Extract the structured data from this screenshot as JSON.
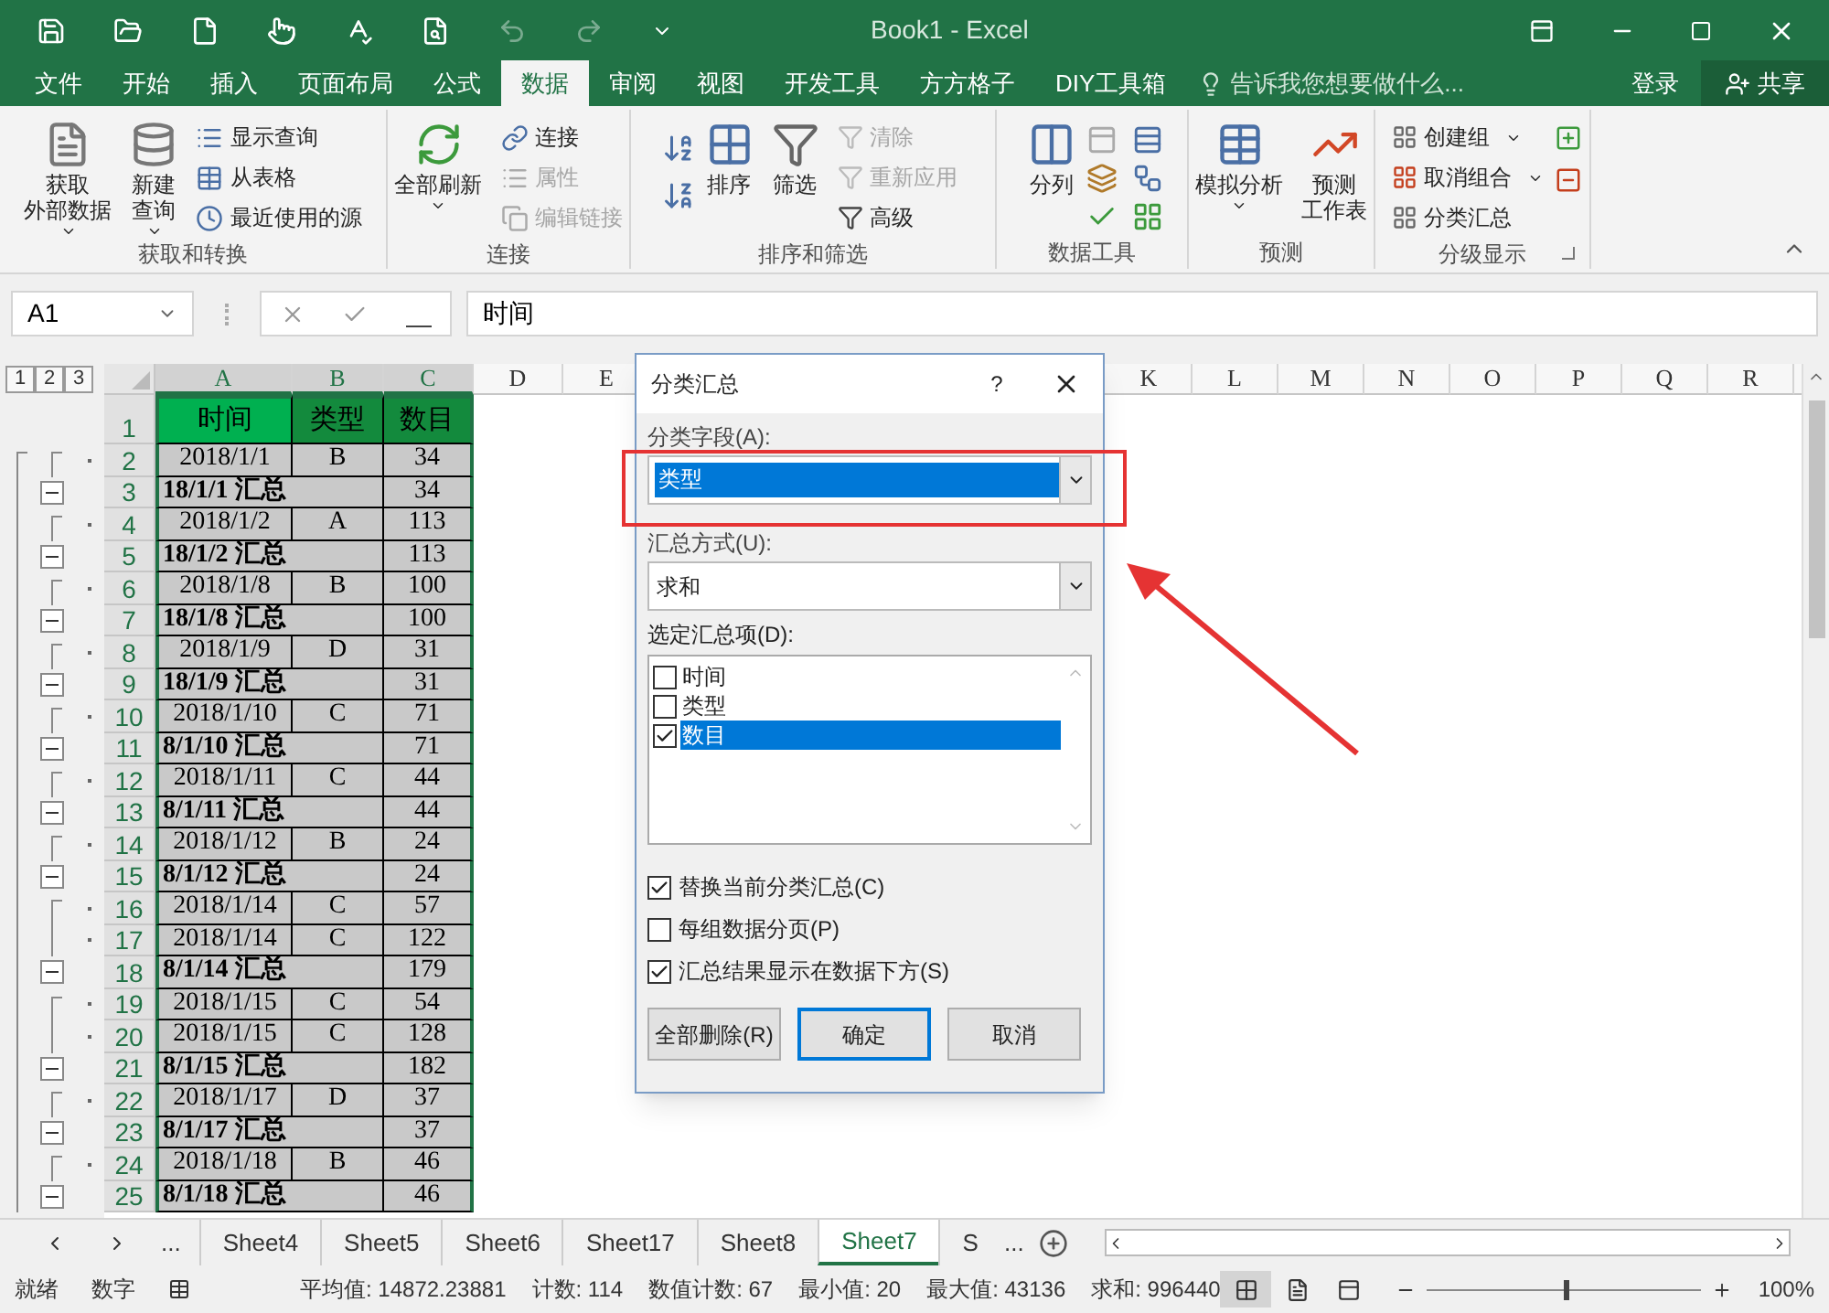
{
  "title_bar": {
    "title": "Book1 - Excel",
    "undo": {
      "disabled": true
    },
    "redo": {
      "disabled": true
    }
  },
  "menu_tabs": [
    {
      "label": "文件",
      "selected": false
    },
    {
      "label": "开始",
      "selected": false
    },
    {
      "label": "插入",
      "selected": false
    },
    {
      "label": "页面布局",
      "selected": false
    },
    {
      "label": "公式",
      "selected": false
    },
    {
      "label": "数据",
      "selected": true
    },
    {
      "label": "审阅",
      "selected": false
    },
    {
      "label": "视图",
      "selected": false
    },
    {
      "label": "开发工具",
      "selected": false
    },
    {
      "label": "方方格子",
      "selected": false
    },
    {
      "label": "DIY工具箱",
      "selected": false
    }
  ],
  "tell_me": {
    "placeholder": "告诉我您想要做什么..."
  },
  "sign_in": "登录",
  "share": "共享",
  "ribbon": {
    "groups": [
      {
        "label": "获取和转换",
        "large": [
          {
            "lines": [
              "获取",
              "外部数据"
            ]
          },
          {
            "lines": [
              "新建",
              "查询"
            ]
          }
        ],
        "small": [
          {
            "label": "显示查询"
          },
          {
            "label": "从表格"
          },
          {
            "label": "最近使用的源"
          }
        ]
      },
      {
        "label": "连接",
        "large": [
          {
            "lines": [
              "全部刷新"
            ]
          }
        ],
        "small": [
          {
            "label": "连接",
            "disabled": false
          },
          {
            "label": "属性",
            "disabled": true
          },
          {
            "label": "编辑链接",
            "disabled": true
          }
        ]
      },
      {
        "label": "排序和筛选",
        "large": [
          {
            "lines": [
              "排序"
            ]
          },
          {
            "lines": [
              "筛选"
            ]
          }
        ],
        "small": [
          {
            "label": "清除",
            "disabled": true
          },
          {
            "label": "重新应用",
            "disabled": true
          },
          {
            "label": "高级",
            "disabled": false
          }
        ]
      },
      {
        "label": "数据工具",
        "large": [
          {
            "lines": [
              "分列"
            ]
          }
        ]
      },
      {
        "label": "预测",
        "large": [
          {
            "lines": [
              "模拟分析"
            ]
          },
          {
            "lines": [
              "预测",
              "工作表"
            ]
          }
        ]
      },
      {
        "label": "分级显示",
        "small": [
          {
            "label": "创建组"
          },
          {
            "label": "取消组合"
          },
          {
            "label": "分类汇总"
          }
        ]
      }
    ]
  },
  "formula_bar": {
    "name_box": "A1",
    "value": "时间"
  },
  "outline_levels": [
    "1",
    "2",
    "3"
  ],
  "columns": [
    {
      "label": "A",
      "selected": true
    },
    {
      "label": "B",
      "selected": true
    },
    {
      "label": "C",
      "selected": true
    },
    {
      "label": "D",
      "selected": false
    },
    {
      "label": "E",
      "selected": false
    },
    {
      "label": "K",
      "selected": false
    },
    {
      "label": "L",
      "selected": false
    },
    {
      "label": "M",
      "selected": false
    },
    {
      "label": "N",
      "selected": false
    },
    {
      "label": "O",
      "selected": false
    },
    {
      "label": "P",
      "selected": false
    },
    {
      "label": "Q",
      "selected": false
    },
    {
      "label": "R",
      "selected": false
    }
  ],
  "rows": [
    {
      "num": "1",
      "kind": "header",
      "a": "时间",
      "b": "类型",
      "c": "数目"
    },
    {
      "num": "2",
      "kind": "detail",
      "a": "2018/1/1",
      "b": "B",
      "c": "34"
    },
    {
      "num": "3",
      "kind": "subtotal",
      "a": "18/1/1 汇总",
      "c": "34"
    },
    {
      "num": "4",
      "kind": "detail",
      "a": "2018/1/2",
      "b": "A",
      "c": "113"
    },
    {
      "num": "5",
      "kind": "subtotal",
      "a": "18/1/2 汇总",
      "c": "113"
    },
    {
      "num": "6",
      "kind": "detail",
      "a": "2018/1/8",
      "b": "B",
      "c": "100"
    },
    {
      "num": "7",
      "kind": "subtotal",
      "a": "18/1/8 汇总",
      "c": "100"
    },
    {
      "num": "8",
      "kind": "detail",
      "a": "2018/1/9",
      "b": "D",
      "c": "31"
    },
    {
      "num": "9",
      "kind": "subtotal",
      "a": "18/1/9 汇总",
      "c": "31"
    },
    {
      "num": "10",
      "kind": "detail",
      "a": "2018/1/10",
      "b": "C",
      "c": "71"
    },
    {
      "num": "11",
      "kind": "subtotal",
      "a": "8/1/10 汇总",
      "c": "71"
    },
    {
      "num": "12",
      "kind": "detail",
      "a": "2018/1/11",
      "b": "C",
      "c": "44"
    },
    {
      "num": "13",
      "kind": "subtotal",
      "a": "8/1/11 汇总",
      "c": "44"
    },
    {
      "num": "14",
      "kind": "detail",
      "a": "2018/1/12",
      "b": "B",
      "c": "24"
    },
    {
      "num": "15",
      "kind": "subtotal",
      "a": "8/1/12 汇总",
      "c": "24"
    },
    {
      "num": "16",
      "kind": "detail",
      "a": "2018/1/14",
      "b": "C",
      "c": "57"
    },
    {
      "num": "17",
      "kind": "detail",
      "a": "2018/1/14",
      "b": "C",
      "c": "122"
    },
    {
      "num": "18",
      "kind": "subtotal",
      "a": "8/1/14 汇总",
      "c": "179"
    },
    {
      "num": "19",
      "kind": "detail",
      "a": "2018/1/15",
      "b": "C",
      "c": "54"
    },
    {
      "num": "20",
      "kind": "detail",
      "a": "2018/1/15",
      "b": "C",
      "c": "128"
    },
    {
      "num": "21",
      "kind": "subtotal",
      "a": "8/1/15 汇总",
      "c": "182"
    },
    {
      "num": "22",
      "kind": "detail",
      "a": "2018/1/17",
      "b": "D",
      "c": "37"
    },
    {
      "num": "23",
      "kind": "subtotal",
      "a": "8/1/17 汇总",
      "c": "37"
    },
    {
      "num": "24",
      "kind": "detail",
      "a": "2018/1/18",
      "b": "B",
      "c": "46"
    },
    {
      "num": "25",
      "kind": "subtotal",
      "a": "8/1/18 汇总",
      "c": "46"
    }
  ],
  "dialog": {
    "title": "分类汇总",
    "help": "?",
    "field_label": "分类字段(A):",
    "field_value": "类型",
    "func_label": "汇总方式(U):",
    "func_value": "求和",
    "items_label": "选定汇总项(D):",
    "items": [
      {
        "label": "时间",
        "checked": false,
        "selected": false
      },
      {
        "label": "类型",
        "checked": false,
        "selected": false
      },
      {
        "label": "数目",
        "checked": true,
        "selected": true
      }
    ],
    "options": [
      {
        "label": "替换当前分类汇总(C)",
        "checked": true
      },
      {
        "label": "每组数据分页(P)",
        "checked": false
      },
      {
        "label": "汇总结果显示在数据下方(S)",
        "checked": true
      }
    ],
    "buttons": [
      {
        "label": "全部删除(R)",
        "default": false
      },
      {
        "label": "确定",
        "default": true
      },
      {
        "label": "取消",
        "default": false
      }
    ]
  },
  "sheet_tabs": {
    "overflow_left": "...",
    "tabs": [
      {
        "label": "Sheet4",
        "selected": false
      },
      {
        "label": "Sheet5",
        "selected": false
      },
      {
        "label": "Sheet6",
        "selected": false
      },
      {
        "label": "Sheet17",
        "selected": false
      },
      {
        "label": "Sheet8",
        "selected": false
      },
      {
        "label": "Sheet7",
        "selected": true
      },
      {
        "label": "S",
        "selected": false
      }
    ],
    "overflow_right": "..."
  },
  "status_bar": {
    "ready": "就绪",
    "mode": "数字",
    "stats": [
      "平均值: 14872.23881",
      "计数: 114",
      "数值计数: 67",
      "最小值: 20",
      "最大值: 43136",
      "求和: 996440"
    ],
    "views": [
      {
        "selected": true
      },
      {
        "selected": false
      },
      {
        "selected": false
      }
    ],
    "zoom_slider": {
      "level": 0.5
    },
    "zoom": "100%"
  }
}
